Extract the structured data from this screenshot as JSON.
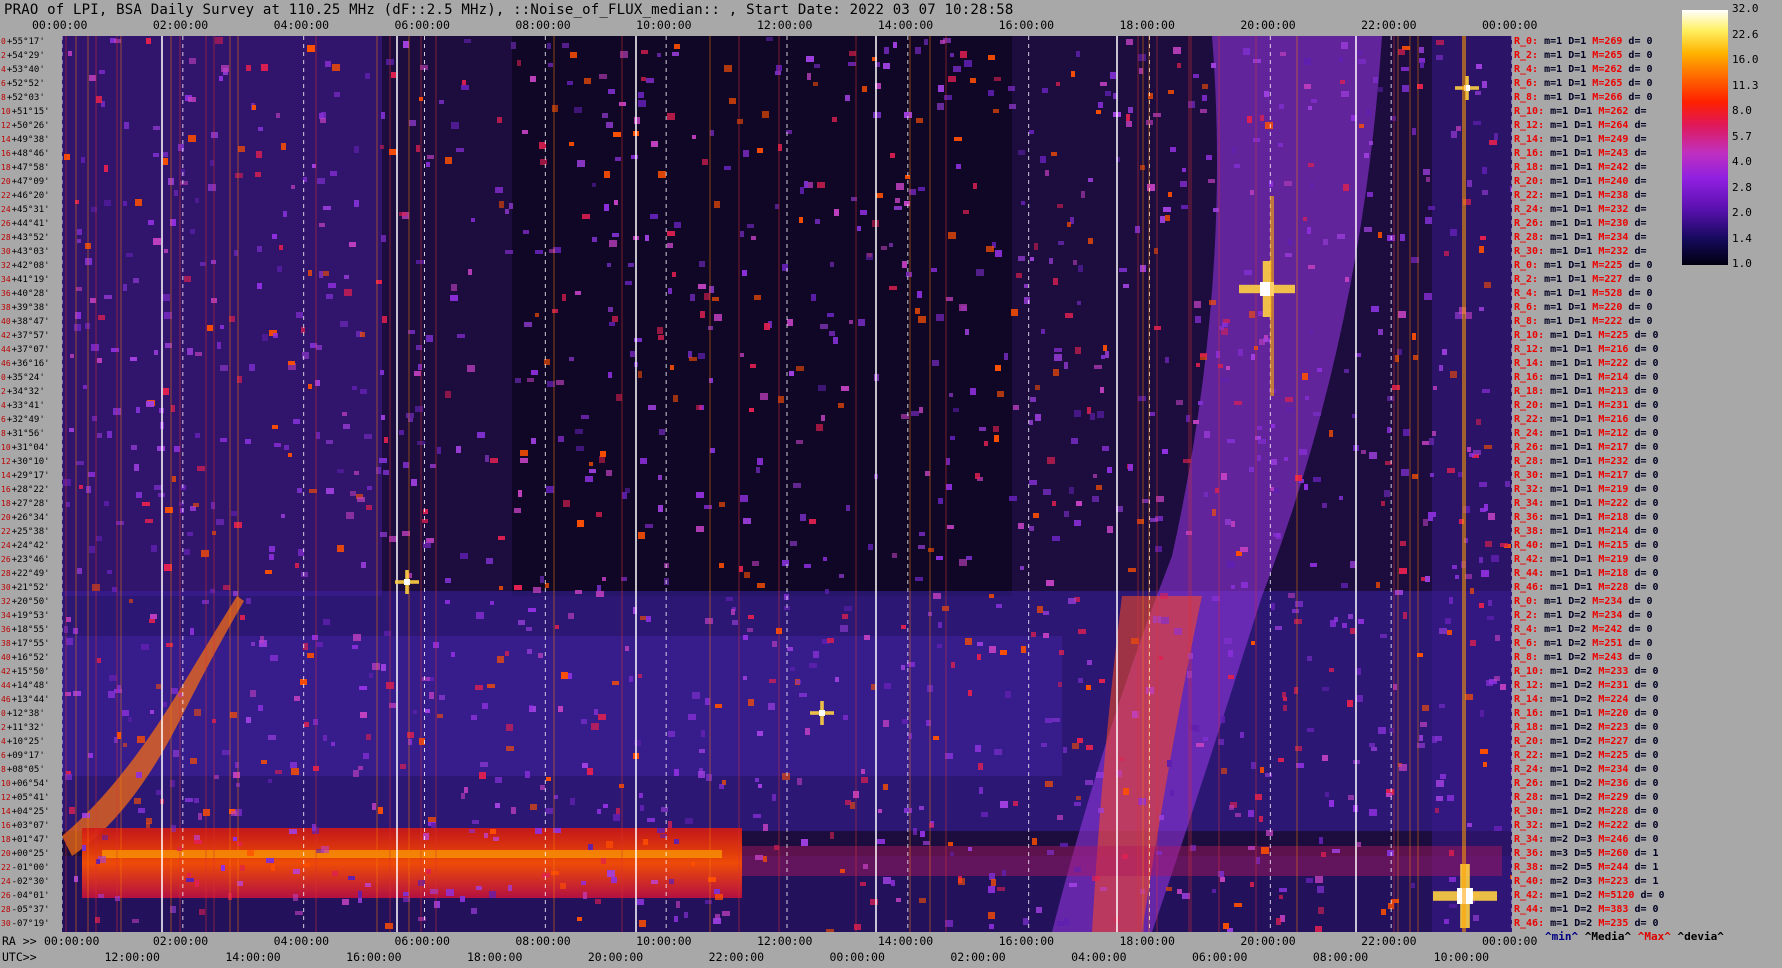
{
  "title": "PRAO of LPI, BSA Daily Survey at 110.25 MHz (dF::2.5 MHz), ::Noise_of_FLUX_median:: , Start Date: 2022 03 07 10:28:58",
  "time_top": [
    "00:00:00",
    "02:00:00",
    "04:00:00",
    "06:00:00",
    "08:00:00",
    "10:00:00",
    "12:00:00",
    "14:00:00",
    "16:00:00",
    "18:00:00",
    "20:00:00",
    "22:00:00",
    "00:00:00"
  ],
  "ra_prefix": "RA >>",
  "utc_prefix": "UTC>>",
  "ra_bottom": [
    "00:00:00",
    "02:00:00",
    "04:00:00",
    "06:00:00",
    "08:00:00",
    "10:00:00",
    "12:00:00",
    "14:00:00",
    "16:00:00",
    "18:00:00",
    "20:00:00",
    "22:00:00",
    "00:00:00"
  ],
  "utc_bottom": [
    "12:00:00",
    "14:00:00",
    "16:00:00",
    "18:00:00",
    "20:00:00",
    "22:00:00",
    "00:00:00",
    "02:00:00",
    "04:00:00",
    "06:00:00",
    "08:00:00",
    "10:00:00"
  ],
  "declinations": [
    [
      "0",
      "+55°17'"
    ],
    [
      "2",
      "+54°29'"
    ],
    [
      "4",
      "+53°40'"
    ],
    [
      "6",
      "+52°52'"
    ],
    [
      "8",
      "+52°03'"
    ],
    [
      "10",
      "+51°15'"
    ],
    [
      "12",
      "+50°26'"
    ],
    [
      "14",
      "+49°38'"
    ],
    [
      "16",
      "+48°46'"
    ],
    [
      "18",
      "+47°58'"
    ],
    [
      "20",
      "+47°09'"
    ],
    [
      "22",
      "+46°20'"
    ],
    [
      "24",
      "+45°31'"
    ],
    [
      "26",
      "+44°41'"
    ],
    [
      "28",
      "+43°52'"
    ],
    [
      "30",
      "+43°03'"
    ],
    [
      "32",
      "+42°08'"
    ],
    [
      "34",
      "+41°19'"
    ],
    [
      "36",
      "+40°28'"
    ],
    [
      "38",
      "+39°38'"
    ],
    [
      "40",
      "+38°47'"
    ],
    [
      "42",
      "+37°57'"
    ],
    [
      "44",
      "+37°07'"
    ],
    [
      "46",
      "+36°16'"
    ],
    [
      "0",
      "+35°24'"
    ],
    [
      "2",
      "+34°32'"
    ],
    [
      "4",
      "+33°41'"
    ],
    [
      "6",
      "+32°49'"
    ],
    [
      "8",
      "+31°56'"
    ],
    [
      "10",
      "+31°04'"
    ],
    [
      "12",
      "+30°10'"
    ],
    [
      "14",
      "+29°17'"
    ],
    [
      "16",
      "+28°22'"
    ],
    [
      "18",
      "+27°28'"
    ],
    [
      "20",
      "+26°34'"
    ],
    [
      "22",
      "+25°38'"
    ],
    [
      "24",
      "+24°42'"
    ],
    [
      "26",
      "+23°46'"
    ],
    [
      "28",
      "+22°49'"
    ],
    [
      "30",
      "+21°52'"
    ],
    [
      "32",
      "+20°50'"
    ],
    [
      "34",
      "+19°53'"
    ],
    [
      "36",
      "+18°55'"
    ],
    [
      "38",
      "+17°55'"
    ],
    [
      "40",
      "+16°52'"
    ],
    [
      "42",
      "+15°50'"
    ],
    [
      "44",
      "+14°48'"
    ],
    [
      "46",
      "+13°44'"
    ],
    [
      "0",
      "+12°38'"
    ],
    [
      "2",
      "+11°32'"
    ],
    [
      "4",
      "+10°25'"
    ],
    [
      "6",
      "+09°17'"
    ],
    [
      "8",
      "+08°05'"
    ],
    [
      "10",
      "+06°54'"
    ],
    [
      "12",
      "+05°41'"
    ],
    [
      "14",
      "+04°25'"
    ],
    [
      "16",
      "+03°07'"
    ],
    [
      "18",
      "+01°47'"
    ],
    [
      "20",
      "+00°25'"
    ],
    [
      "22",
      "-01°00'"
    ],
    [
      "24",
      "-02°30'"
    ],
    [
      "26",
      "-04°01'"
    ],
    [
      "28",
      "-05°37'"
    ],
    [
      "30",
      "-07°19'"
    ]
  ],
  "right_rows": [
    [
      "R_0:",
      "m=1",
      "D=1",
      "M=269",
      "d= 0"
    ],
    [
      "R_2:",
      "m=1",
      "D=1",
      "M=265",
      "d= 0"
    ],
    [
      "R_4:",
      "m=1",
      "D=1",
      "M=262",
      "d= 0"
    ],
    [
      "R_6:",
      "m=1",
      "D=1",
      "M=265",
      "d= 0"
    ],
    [
      "R_8:",
      "m=1",
      "D=1",
      "M=266",
      "d= 0"
    ],
    [
      "R_10:",
      "m=1",
      "D=1",
      "M=262",
      "d="
    ],
    [
      "R_12:",
      "m=1",
      "D=1",
      "M=264",
      "d="
    ],
    [
      "R_14:",
      "m=1",
      "D=1",
      "M=249",
      "d="
    ],
    [
      "R_16:",
      "m=1",
      "D=1",
      "M=243",
      "d="
    ],
    [
      "R_18:",
      "m=1",
      "D=1",
      "M=242",
      "d="
    ],
    [
      "R_20:",
      "m=1",
      "D=1",
      "M=240",
      "d="
    ],
    [
      "R_22:",
      "m=1",
      "D=1",
      "M=238",
      "d="
    ],
    [
      "R_24:",
      "m=1",
      "D=1",
      "M=232",
      "d="
    ],
    [
      "R_26:",
      "m=1",
      "D=1",
      "M=230",
      "d="
    ],
    [
      "R_28:",
      "m=1",
      "D=1",
      "M=234",
      "d="
    ],
    [
      "R_30:",
      "m=1",
      "D=1",
      "M=232",
      "d="
    ],
    [
      "R_0:",
      "m=1",
      "D=1",
      "M=225",
      "d= 0"
    ],
    [
      "R_2:",
      "m=1",
      "D=1",
      "M=227",
      "d= 0"
    ],
    [
      "R_4:",
      "m=1",
      "D=1",
      "M=528",
      "d= 0"
    ],
    [
      "R_6:",
      "m=1",
      "D=1",
      "M=220",
      "d= 0"
    ],
    [
      "R_8:",
      "m=1",
      "D=1",
      "M=222",
      "d= 0"
    ],
    [
      "R_10:",
      "m=1",
      "D=1",
      "M=225",
      "d= 0"
    ],
    [
      "R_12:",
      "m=1",
      "D=1",
      "M=216",
      "d= 0"
    ],
    [
      "R_14:",
      "m=1",
      "D=1",
      "M=222",
      "d= 0"
    ],
    [
      "R_16:",
      "m=1",
      "D=1",
      "M=214",
      "d= 0"
    ],
    [
      "R_18:",
      "m=1",
      "D=1",
      "M=213",
      "d= 0"
    ],
    [
      "R_20:",
      "m=1",
      "D=1",
      "M=231",
      "d= 0"
    ],
    [
      "R_22:",
      "m=1",
      "D=1",
      "M=216",
      "d= 0"
    ],
    [
      "R_24:",
      "m=1",
      "D=1",
      "M=212",
      "d= 0"
    ],
    [
      "R_26:",
      "m=1",
      "D=1",
      "M=217",
      "d= 0"
    ],
    [
      "R_28:",
      "m=1",
      "D=1",
      "M=232",
      "d= 0"
    ],
    [
      "R_30:",
      "m=1",
      "D=1",
      "M=217",
      "d= 0"
    ],
    [
      "R_32:",
      "m=1",
      "D=1",
      "M=219",
      "d= 0"
    ],
    [
      "R_34:",
      "m=1",
      "D=1",
      "M=222",
      "d= 0"
    ],
    [
      "R_36:",
      "m=1",
      "D=1",
      "M=218",
      "d= 0"
    ],
    [
      "R_38:",
      "m=1",
      "D=1",
      "M=214",
      "d= 0"
    ],
    [
      "R_40:",
      "m=1",
      "D=1",
      "M=215",
      "d= 0"
    ],
    [
      "R_42:",
      "m=1",
      "D=1",
      "M=219",
      "d= 0"
    ],
    [
      "R_44:",
      "m=1",
      "D=1",
      "M=218",
      "d= 0"
    ],
    [
      "R_46:",
      "m=1",
      "D=1",
      "M=228",
      "d= 0"
    ],
    [
      "R_0:",
      "m=1",
      "D=2",
      "M=234",
      "d= 0"
    ],
    [
      "R_2:",
      "m=1",
      "D=2",
      "M=234",
      "d= 0"
    ],
    [
      "R_4:",
      "m=1",
      "D=2",
      "M=242",
      "d= 0"
    ],
    [
      "R_6:",
      "m=1",
      "D=2",
      "M=251",
      "d= 0"
    ],
    [
      "R_8:",
      "m=1",
      "D=2",
      "M=243",
      "d= 0"
    ],
    [
      "R_10:",
      "m=1",
      "D=2",
      "M=233",
      "d= 0"
    ],
    [
      "R_12:",
      "m=1",
      "D=2",
      "M=231",
      "d= 0"
    ],
    [
      "R_14:",
      "m=1",
      "D=2",
      "M=224",
      "d= 0"
    ],
    [
      "R_16:",
      "m=1",
      "D=1",
      "M=220",
      "d= 0"
    ],
    [
      "R_18:",
      "m=1",
      "D=2",
      "M=223",
      "d= 0"
    ],
    [
      "R_20:",
      "m=1",
      "D=2",
      "M=227",
      "d= 0"
    ],
    [
      "R_22:",
      "m=1",
      "D=2",
      "M=225",
      "d= 0"
    ],
    [
      "R_24:",
      "m=1",
      "D=2",
      "M=234",
      "d= 0"
    ],
    [
      "R_26:",
      "m=1",
      "D=2",
      "M=236",
      "d= 0"
    ],
    [
      "R_28:",
      "m=1",
      "D=2",
      "M=229",
      "d= 0"
    ],
    [
      "R_30:",
      "m=1",
      "D=2",
      "M=228",
      "d= 0"
    ],
    [
      "R_32:",
      "m=1",
      "D=2",
      "M=222",
      "d= 0"
    ],
    [
      "R_34:",
      "m=2",
      "D=3",
      "M=246",
      "d= 0"
    ],
    [
      "R_36:",
      "m=3",
      "D=5",
      "M=260",
      "d= 1"
    ],
    [
      "R_38:",
      "m=2",
      "D=5",
      "M=244",
      "d= 1"
    ],
    [
      "R_40:",
      "m=2",
      "D=3",
      "M=223",
      "d= 1"
    ],
    [
      "R_42:",
      "m=1",
      "D=2",
      "M=5120",
      "d= 0"
    ],
    [
      "R_44:",
      "m=1",
      "D=2",
      "M=383",
      "d= 0"
    ],
    [
      "R_46:",
      "m=1",
      "D=2",
      "M=235",
      "d= 0"
    ]
  ],
  "colorbar_ticks": [
    "32.0",
    "22.6",
    "16.0",
    "11.3",
    "8.0",
    "5.7",
    "4.0",
    "2.8",
    "2.0",
    "1.4",
    "1.0"
  ],
  "legend": {
    "min": "^min^",
    "median": "^Media^",
    "max": "^Max^",
    "devia": "^devia^"
  },
  "colors": {
    "background": "#a8a8a8",
    "plot_bg": "#1b0c3a",
    "label_red": "#e00000",
    "label_blue": "#000080"
  }
}
